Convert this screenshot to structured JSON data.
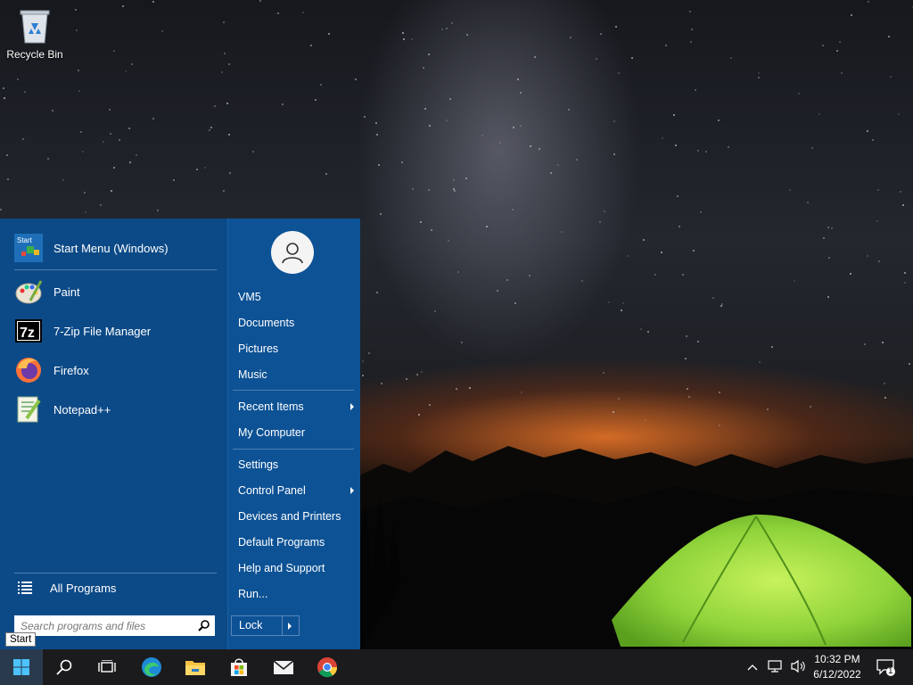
{
  "desktop": {
    "icons": [
      {
        "label": "Recycle Bin",
        "icon": "recycle-bin-icon"
      }
    ]
  },
  "start_menu": {
    "pinned": [
      {
        "label": "Start Menu (Windows)",
        "icon": "start-menu-icon",
        "icon_text": "Start"
      }
    ],
    "programs": [
      {
        "label": "Paint",
        "icon": "paint-icon"
      },
      {
        "label": "7-Zip File Manager",
        "icon": "7zip-icon",
        "icon_text": "7z"
      },
      {
        "label": "Firefox",
        "icon": "firefox-icon"
      },
      {
        "label": "Notepad++",
        "icon": "notepadpp-icon"
      }
    ],
    "all_programs": "All Programs",
    "search_placeholder": "Search programs and files",
    "user_name": "VM5",
    "places": [
      "Documents",
      "Pictures",
      "Music"
    ],
    "recent_items": "Recent Items",
    "my_computer": "My Computer",
    "settings": "Settings",
    "control_panel": "Control Panel",
    "devices_printers": "Devices and Printers",
    "default_programs": "Default Programs",
    "help_support": "Help and Support",
    "run": "Run...",
    "lock": "Lock"
  },
  "tooltip": "Start",
  "taskbar": {
    "buttons": [
      "windows-start-icon",
      "search-icon",
      "task-view-icon",
      "edge-icon",
      "file-explorer-icon",
      "store-icon",
      "mail-icon",
      "chrome-icon"
    ],
    "clock_time": "10:32 PM",
    "clock_date": "6/12/2022",
    "notification_count": "1"
  },
  "colors": {
    "start_menu_bg": "#0e4f8f",
    "taskbar_bg": "#1b1b1d",
    "accent": "#0078d7"
  }
}
